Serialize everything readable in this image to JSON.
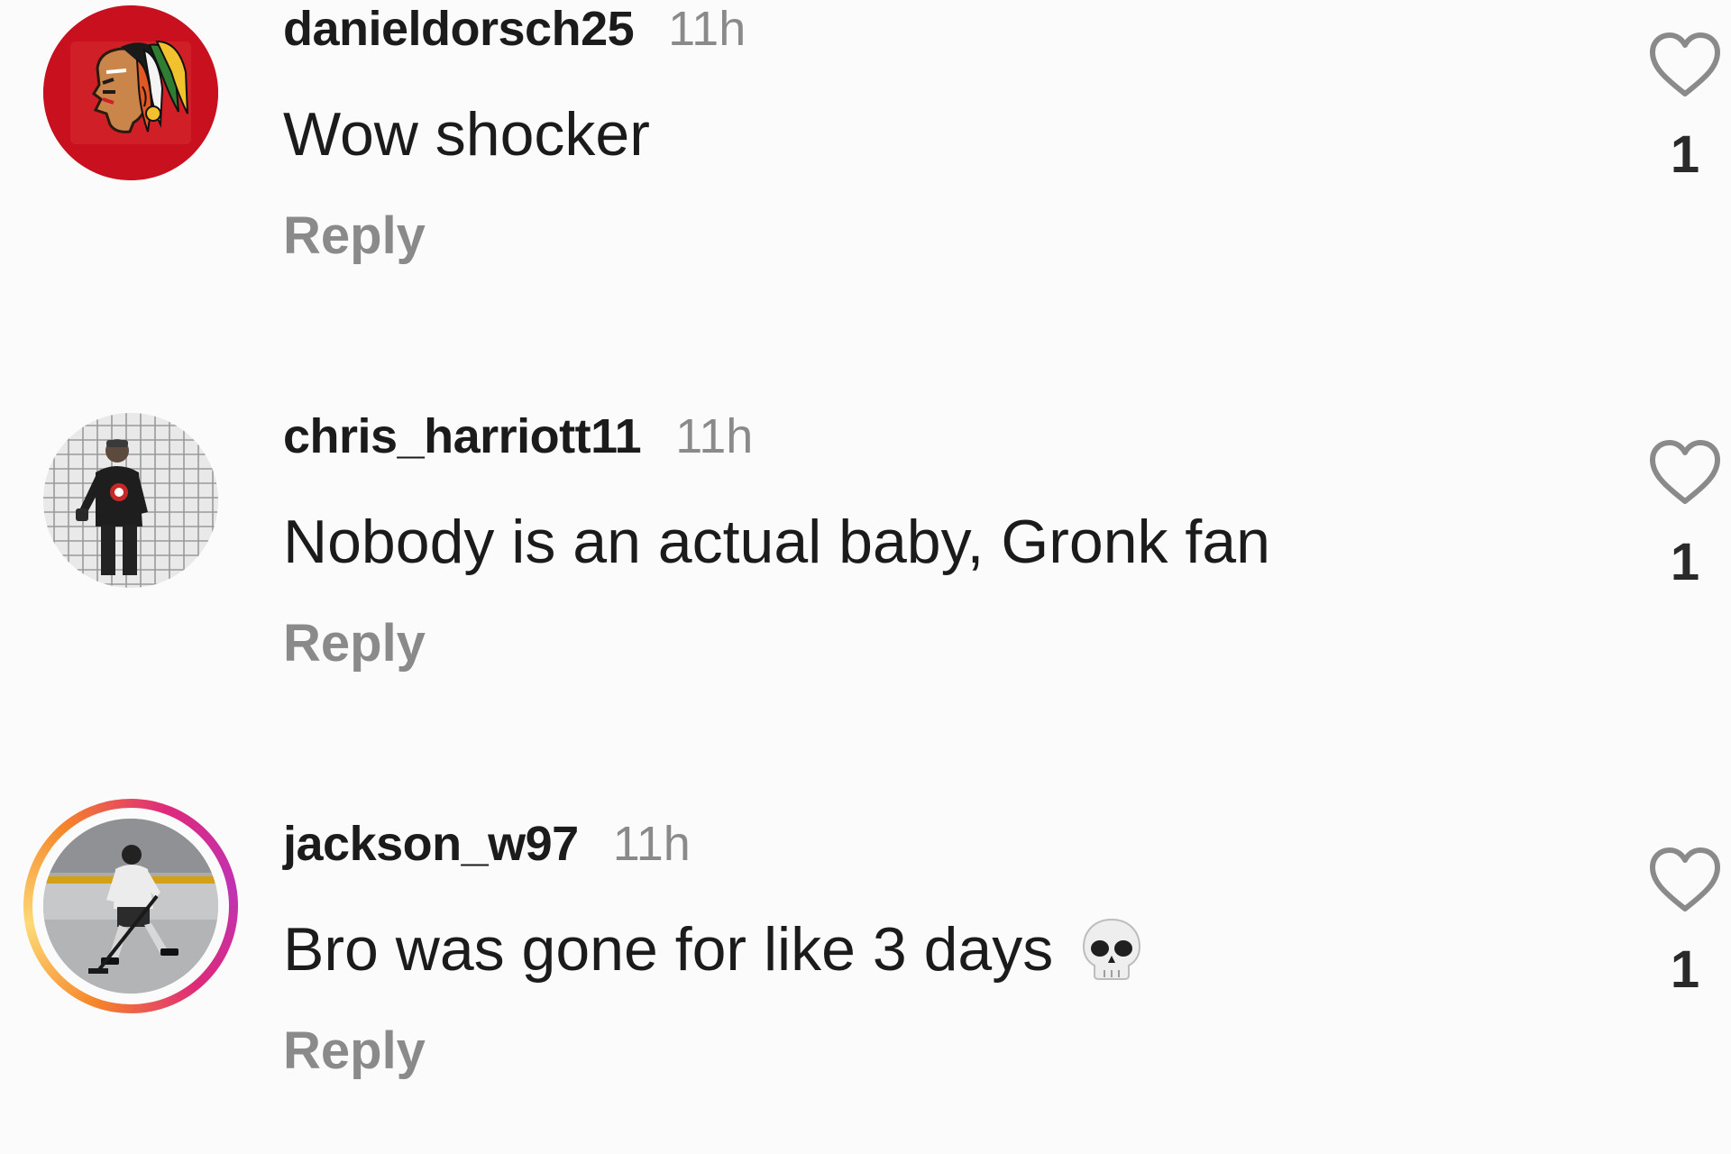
{
  "comments": [
    {
      "username": "danieldorsch25",
      "time": "11h",
      "text": "Wow shocker",
      "reply_label": "Reply",
      "likes": "1",
      "avatar_icon": "hockey-team-logo-avatar",
      "has_story_ring": false
    },
    {
      "username": "chris_harriott11",
      "time": "11h",
      "text": "Nobody is an actual baby, Gronk fan",
      "reply_label": "Reply",
      "likes": "1",
      "avatar_icon": "goalie-net-photo-avatar",
      "has_story_ring": false
    },
    {
      "username": "jackson_w97",
      "time": "11h",
      "text": "Bro was gone for like 3 days",
      "emoji": "skull-emoji",
      "reply_label": "Reply",
      "likes": "1",
      "avatar_icon": "hockey-player-photo-avatar",
      "has_story_ring": true
    }
  ],
  "colors": {
    "background": "#fbfbfb",
    "username": "#1b1b1b",
    "secondary_text": "#8a8a8a",
    "story_ring_gradient": [
      "#f58529",
      "#feda77",
      "#dd2a7b",
      "#c032b3"
    ]
  }
}
